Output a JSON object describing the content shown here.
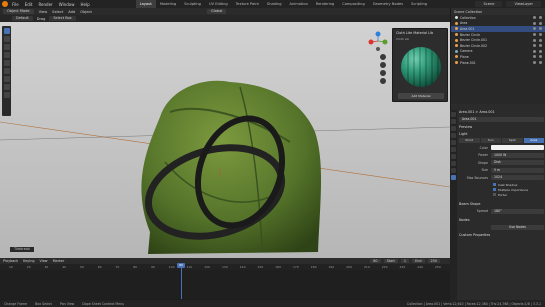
{
  "topbar": {
    "menus": [
      "File",
      "Edit",
      "Render",
      "Window",
      "Help"
    ],
    "workspaces": [
      "Layout",
      "Modeling",
      "Sculpting",
      "UV Editing",
      "Texture Paint",
      "Shading",
      "Animation",
      "Rendering",
      "Compositing",
      "Geometry Nodes",
      "Scripting"
    ],
    "active_workspace": "Layout",
    "scene": "Scene",
    "view_layer": "ViewLayer"
  },
  "viewport_header": {
    "mode": "Object Mode",
    "menus": [
      "View",
      "Select",
      "Add",
      "Object"
    ],
    "orientation": "Global",
    "pivot": "Default",
    "snap": "Drag",
    "snap_target": "Select Box"
  },
  "viewport": {
    "overlay_text": "Tiled View",
    "status_label": "Tilebreak"
  },
  "material_popup": {
    "title": "Cloth Lite Material Lib",
    "subtitle": "Cloth Lib",
    "button": "Add Material"
  },
  "outliner": {
    "header": "Scene Collection",
    "items": [
      {
        "label": "Collection",
        "selected": false
      },
      {
        "label": "Area",
        "selected": false
      },
      {
        "label": "Area.001",
        "selected": true
      },
      {
        "label": "Bezier Circle",
        "selected": false
      },
      {
        "label": "Bezier Circle.001",
        "selected": false
      },
      {
        "label": "Bezier Circle.002",
        "selected": false
      },
      {
        "label": "Camera",
        "selected": false
      },
      {
        "label": "Plane",
        "selected": false
      },
      {
        "label": "Plane.001",
        "selected": false
      }
    ]
  },
  "properties": {
    "breadcrumb": "Area.001 > Area.001",
    "object_name": "Area.001",
    "preview": "Preview",
    "light": "Light",
    "light_types": [
      "Point",
      "Sun",
      "Spot",
      "Area"
    ],
    "active_light_type": "Area",
    "fields": [
      {
        "label": "Color",
        "value": ""
      },
      {
        "label": "Power",
        "value": "1000 W"
      },
      {
        "label": "Shape",
        "value": "Disk"
      },
      {
        "label": "Size",
        "value": "5 m"
      },
      {
        "label": "Max Bounces",
        "value": "1024"
      }
    ],
    "checks": [
      "Cast Shadow",
      "Multiple Importance",
      "Portal"
    ],
    "beam_shape": "Beam Shape",
    "spread_label": "Spread",
    "spread_value": "180°",
    "nodes": "Nodes",
    "use_nodes": "Use Nodes",
    "custom_props": "Custom Properties"
  },
  "timeline": {
    "menus": [
      "Playback",
      "Keying",
      "View",
      "Marker"
    ],
    "current_frame": "80",
    "start_label": "Start",
    "start": "1",
    "end_label": "End",
    "end": "250",
    "ticks": [
      "10",
      "20",
      "30",
      "40",
      "50",
      "60",
      "70",
      "80",
      "90",
      "100",
      "110",
      "120",
      "130",
      "140",
      "150",
      "160",
      "170",
      "180",
      "190",
      "200",
      "210",
      "220",
      "230",
      "240",
      "250"
    ]
  },
  "statusbar": {
    "items": [
      "Change Frame",
      "Box Select",
      "Pan View",
      "Dope Sheet Context Menu"
    ],
    "version": "Collection | Area.001 | Verts:12,610 | Faces:12,384 | Tris:24,768 | Objects:1/8 | 3.3.1"
  },
  "colors": {
    "accent": "#4772b3",
    "cloth": "#5c7a2c",
    "viewport_bg": "#cbcbcb"
  }
}
